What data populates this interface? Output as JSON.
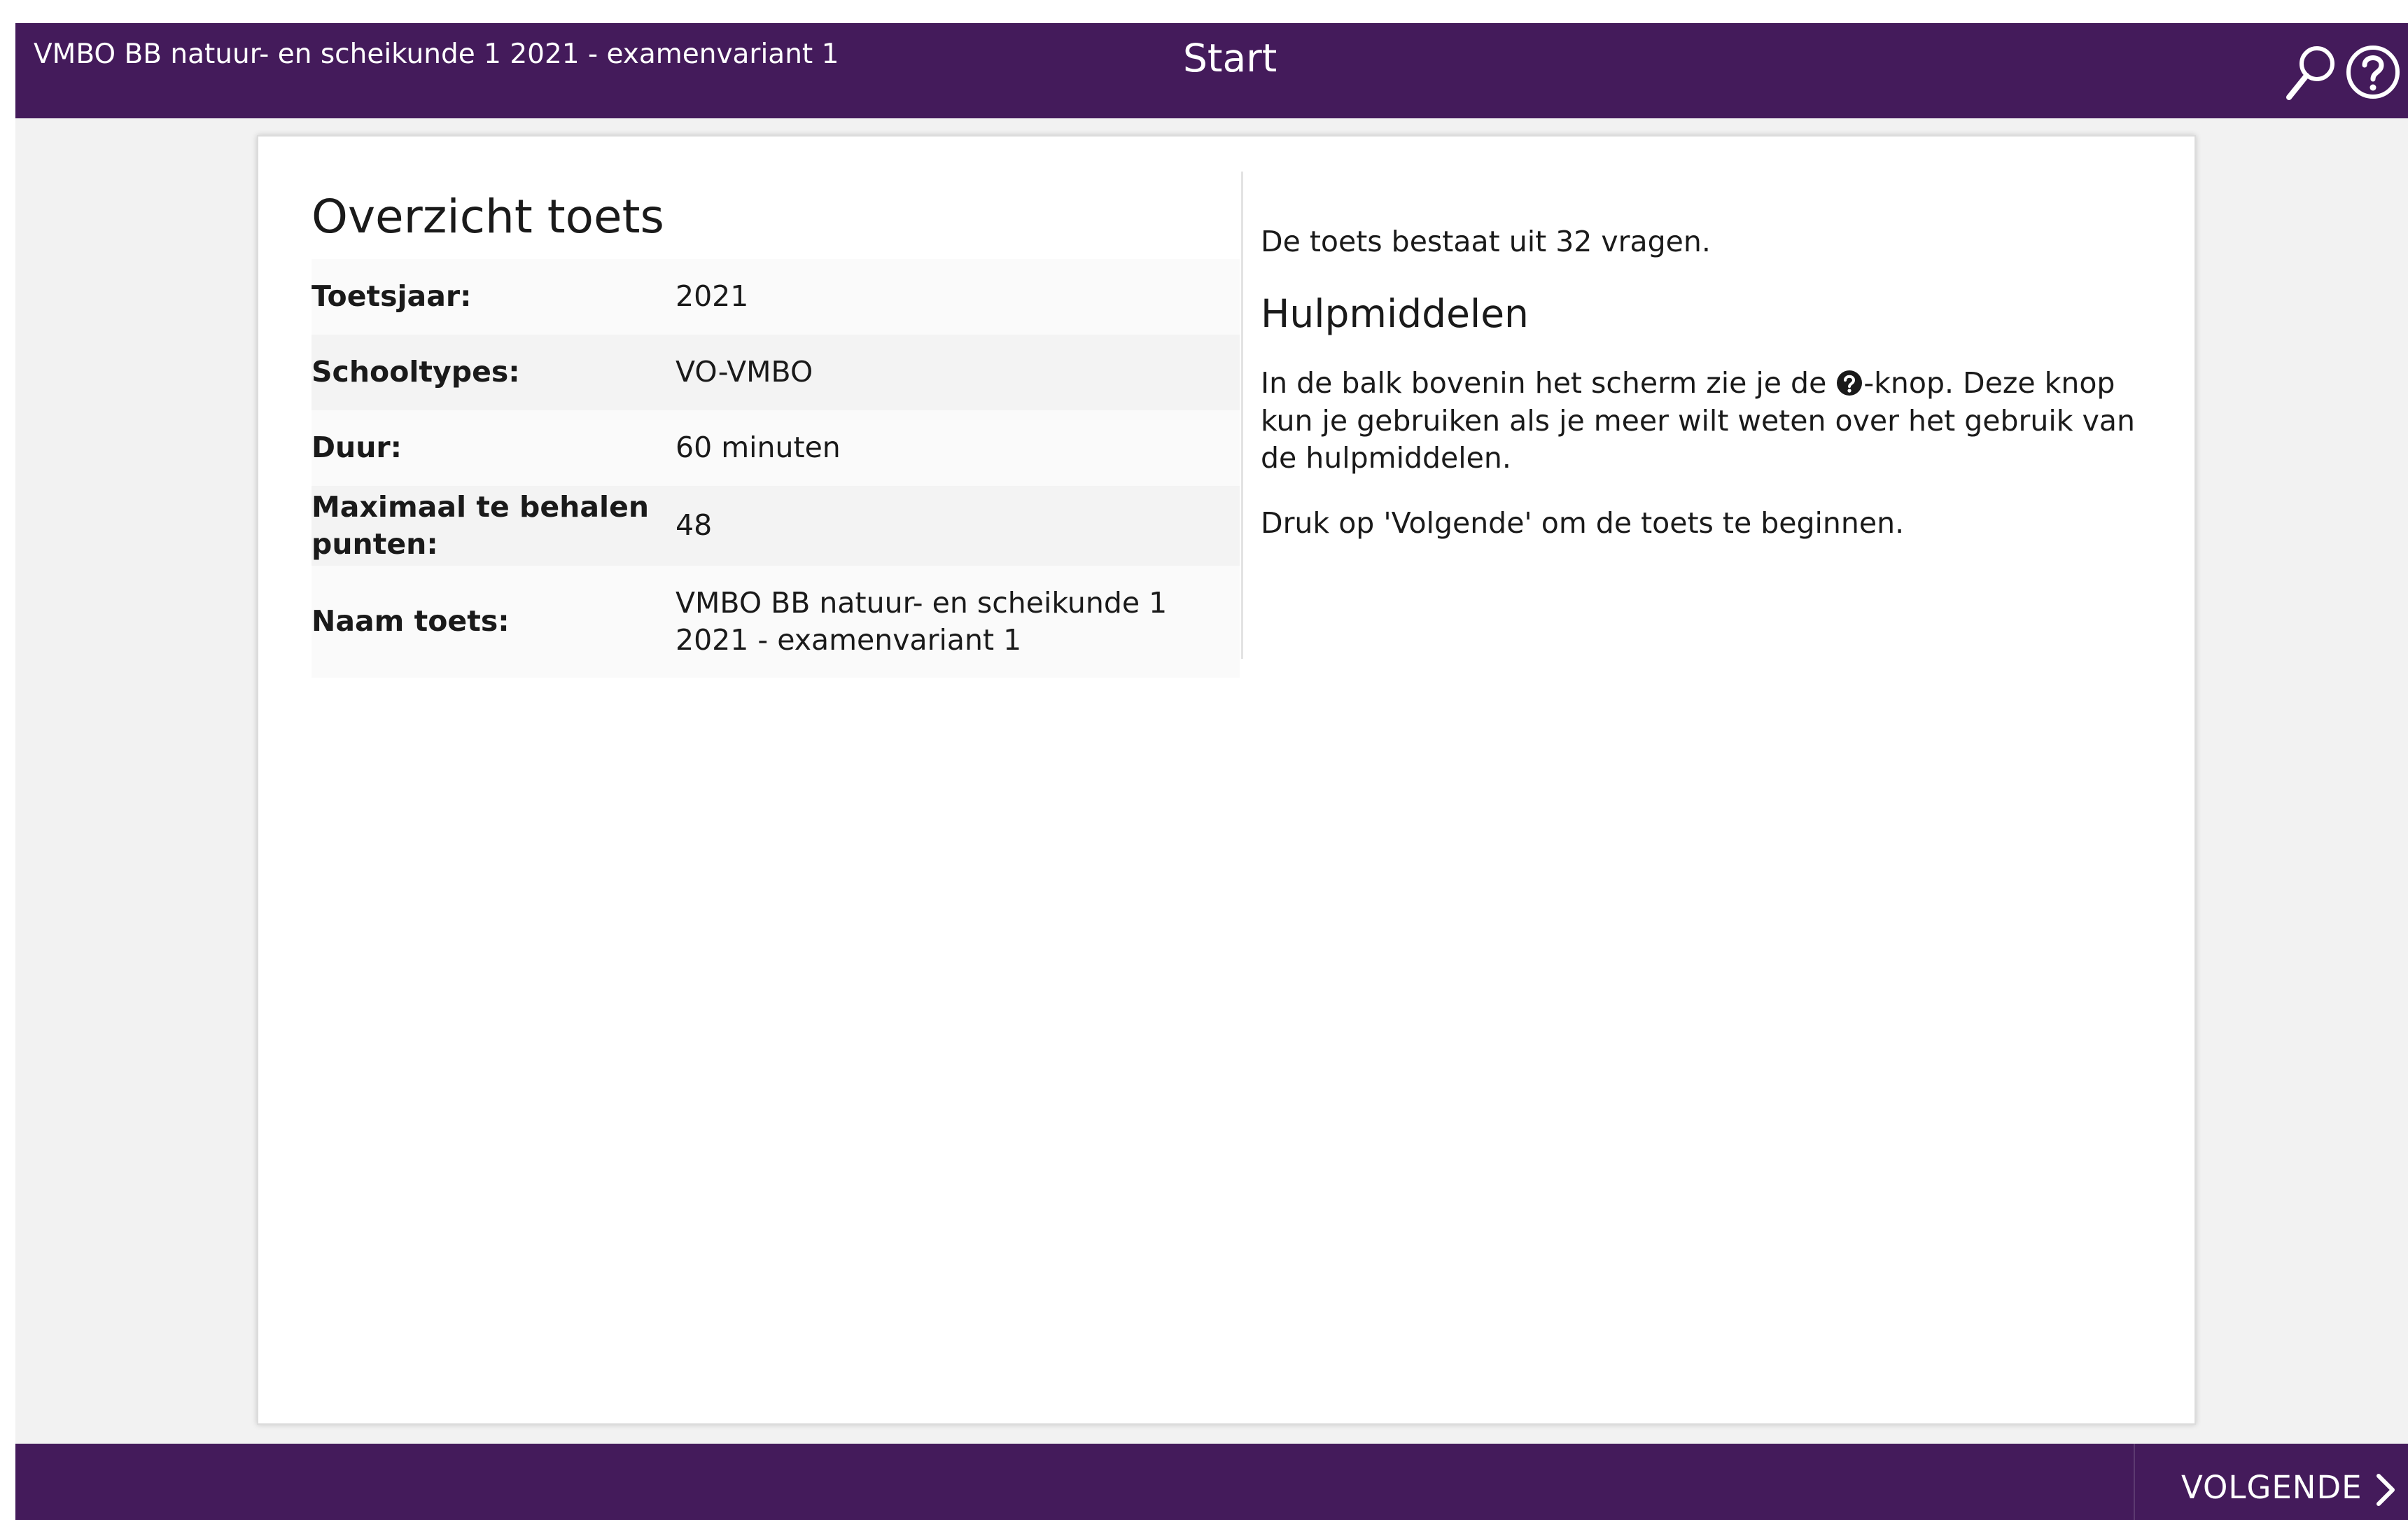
{
  "header": {
    "exam_title": "VMBO BB natuur- en scheikunde 1 2021 - examenvariant 1",
    "page_title": "Start",
    "icons": [
      "search-icon",
      "help-icon"
    ]
  },
  "overview": {
    "title": "Overzicht toets",
    "rows": [
      {
        "label": "Toetsjaar:",
        "value": "2021"
      },
      {
        "label": "Schooltypes:",
        "value": "VO-VMBO"
      },
      {
        "label": "Duur:",
        "value": "60 minuten"
      },
      {
        "label": "Maximaal te behalen punten:",
        "value": "48"
      },
      {
        "label": "Naam toets:",
        "value": "VMBO BB natuur- en scheikunde 1 2021 - examenvariant 1"
      }
    ]
  },
  "info": {
    "intro": "De toets bestaat uit 32 vragen.",
    "help_heading": "Hulpmiddelen",
    "help_text_before": "In de balk bovenin het scherm zie je de ",
    "help_text_after": "-knop. Deze knop kun je gebruiken als je meer wilt weten over het gebruik van de hulpmiddelen.",
    "start_text": "Druk op 'Volgende' om de toets te beginnen."
  },
  "footer": {
    "next_label": "VOLGENDE"
  },
  "colors": {
    "brand": "#441b5b",
    "background": "#f2f2f2"
  }
}
